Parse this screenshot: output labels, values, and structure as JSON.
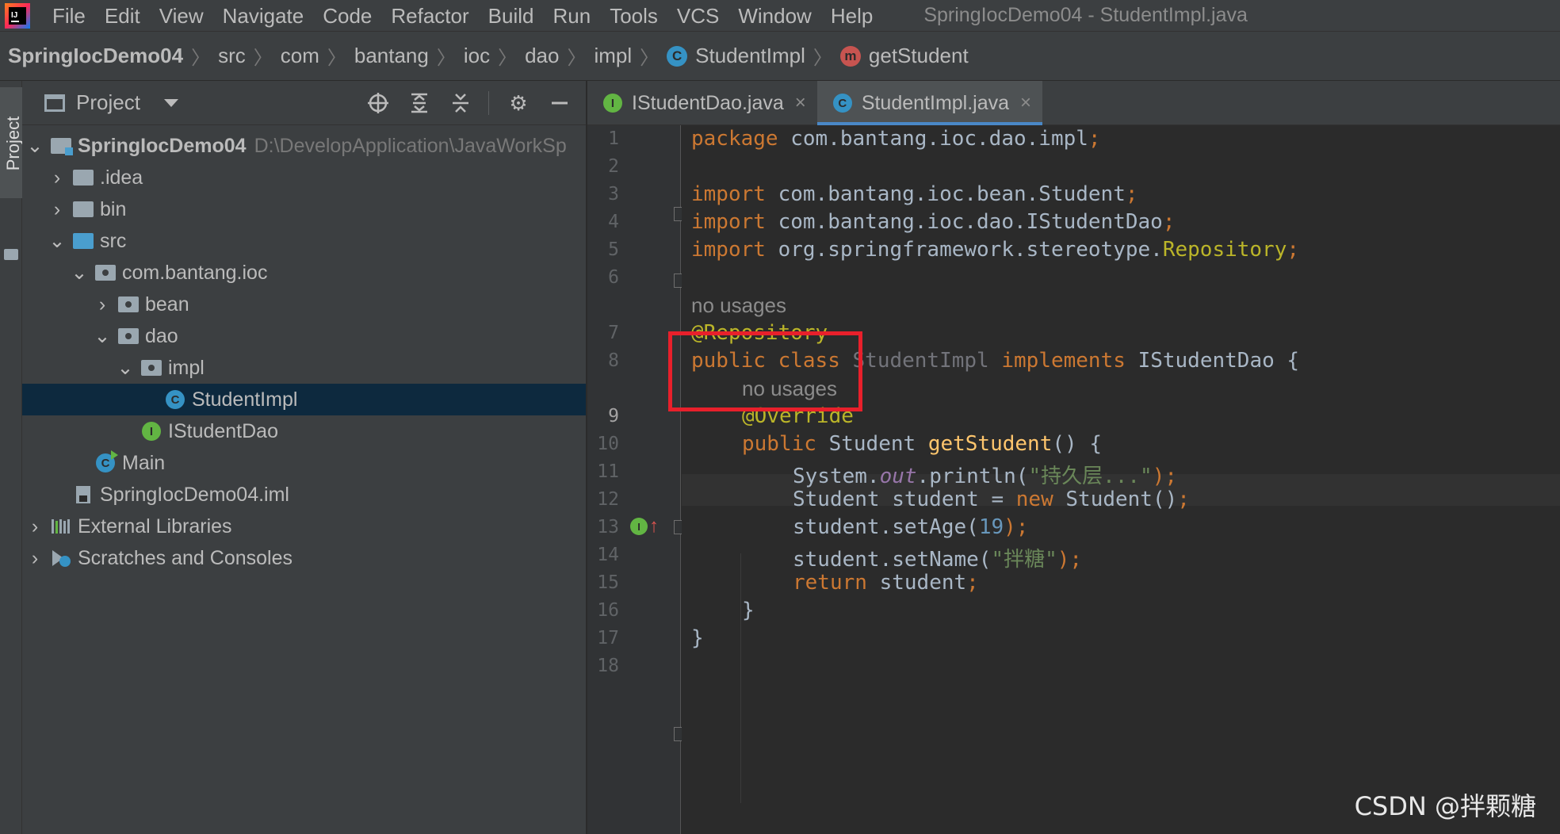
{
  "menu": {
    "items": [
      "File",
      "Edit",
      "View",
      "Navigate",
      "Code",
      "Refactor",
      "Build",
      "Run",
      "Tools",
      "VCS",
      "Window",
      "Help"
    ],
    "window_title": "SpringIocDemo04 - StudentImpl.java"
  },
  "breadcrumb": {
    "project": "SpringIocDemo04",
    "parts": [
      "src",
      "com",
      "bantang",
      "ioc",
      "dao",
      "impl"
    ],
    "class_name": "StudentImpl",
    "method_name": "getStudent",
    "class_icon_letter": "C",
    "method_icon_letter": "m"
  },
  "sidebar": {
    "stripe_label": "Project",
    "panel_title": "Project"
  },
  "tree": {
    "root_name": "SpringIocDemo04",
    "root_path": "D:\\DevelopApplication\\JavaWorkSp",
    "idea": ".idea",
    "bin": "bin",
    "src": "src",
    "pkg": "com.bantang.ioc",
    "bean": "bean",
    "dao": "dao",
    "impl": "impl",
    "student_impl": "StudentImpl",
    "istudent_dao": "IStudentDao",
    "main": "Main",
    "iml": "SpringIocDemo04.iml",
    "ext_libs": "External Libraries",
    "scratches": "Scratches and Consoles"
  },
  "tabs": [
    {
      "label": "IStudentDao.java",
      "icon": "I",
      "active": false
    },
    {
      "label": "StudentImpl.java",
      "icon": "C",
      "active": true
    }
  ],
  "editor": {
    "line_numbers": [
      "1",
      "2",
      "3",
      "4",
      "5",
      "6",
      "7",
      "8",
      "9",
      "10",
      "11",
      "12",
      "13",
      "14",
      "15",
      "16",
      "17",
      "18"
    ],
    "hint_no_usages": "no usages",
    "pkg_kw": "package",
    "pkg_name": " com.bantang.ioc.dao.impl",
    "import_kw": "import",
    "import1": " com.bantang.ioc.bean.Student",
    "import2": " com.bantang.ioc.dao.IStudentDao",
    "import3_pre": " org.springframework.stereotype.",
    "import3_cls": "Repository",
    "semicolon": ";",
    "repository_ann": "@Repository",
    "public_kw": "public",
    "class_kw": "class",
    "class_name": "StudentImpl",
    "implements_kw": "implements",
    "iface": "IStudentDao {",
    "override_ann": "@Override",
    "ret_type": "Student",
    "method": "getStudent",
    "method_sig_end": "() {",
    "sysout_pre": "System.",
    "sysout_out": "out",
    "sysout_post": ".println(",
    "str1": "\"持久层...\"",
    "close_paren_semi": ");",
    "stu_decl": "Student student = ",
    "new_kw": "new",
    "stu_ctor": " Student()",
    "set_age_pre": "student.setAge(",
    "age": "19",
    "set_name_pre": "student.setName(",
    "str2": "\"拌糖\"",
    "return_kw": "return",
    "return_val": " student",
    "close_brace": "}"
  },
  "watermark": "CSDN @拌颗糖"
}
